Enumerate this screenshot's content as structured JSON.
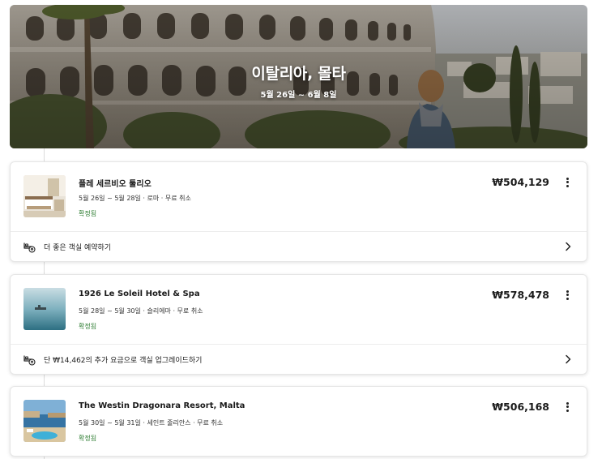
{
  "trip": {
    "title": "이탈리아, 몰타",
    "dates": "5월 26일 ~ 6월 8일"
  },
  "bookings": [
    {
      "name": "플레 세르비오 툴리오",
      "meta": "5월 26일 ~ 5월 28일 · 로마 · 무료 취소",
      "status": "확정됨",
      "price": "₩504,129",
      "upsell": "더 좋은 객실 예약하기"
    },
    {
      "name": "1926 Le Soleil Hotel & Spa",
      "meta": "5월 28일 ~ 5월 30일 · 슬리에마 · 무료 취소",
      "status": "확정됨",
      "price": "₩578,478",
      "upsell": "단 ₩14,462의 추가 요금으로 객실 업그레이드하기"
    },
    {
      "name": "The Westin Dragonara Resort, Malta",
      "meta": "5월 30일 ~ 5월 31일 · 세인트 줄리안스 · 무료 취소",
      "status": "확정됨",
      "price": "₩506,168"
    }
  ],
  "colors": {
    "confirmed": "#2e7d32",
    "divider": "#ececec"
  },
  "icons": {
    "more": "more-vertical-icon",
    "upgrade": "bed-upgrade-icon",
    "chevron": "chevron-right-icon"
  }
}
